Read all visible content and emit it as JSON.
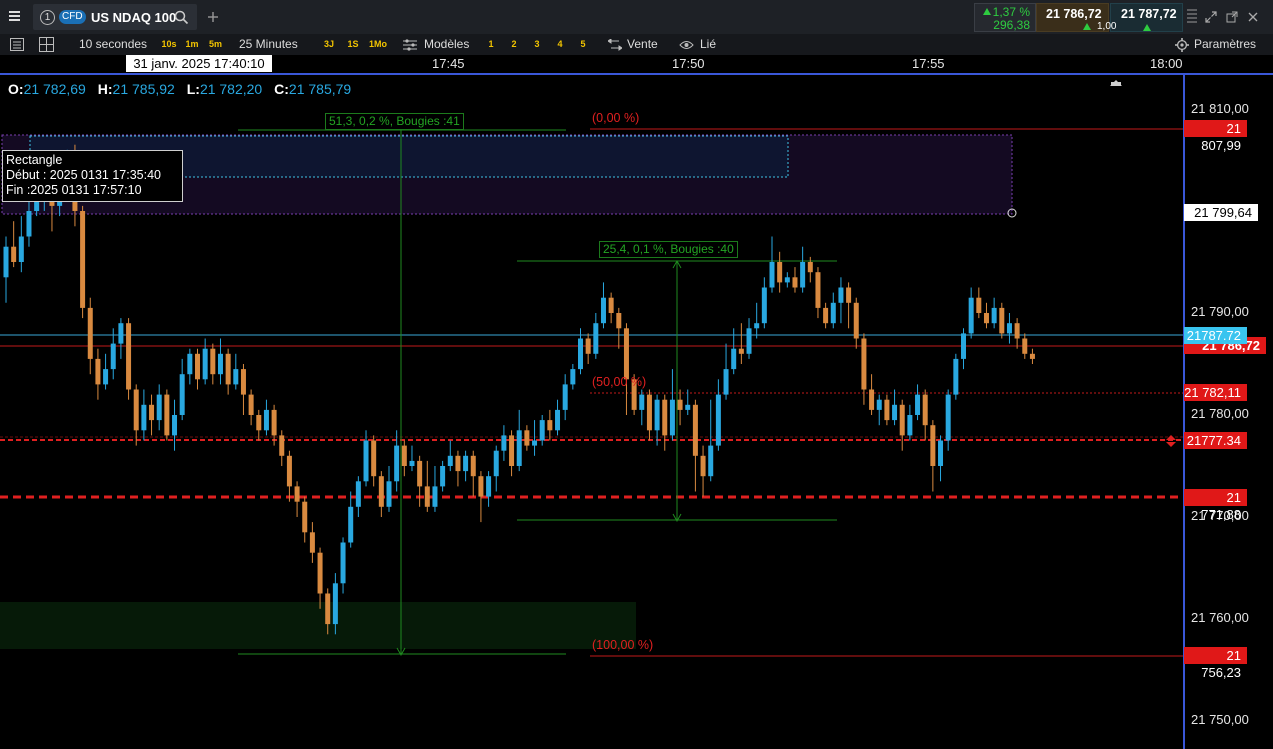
{
  "header": {
    "tab_number": "1",
    "cfd_badge": "CFD",
    "instrument": "US NDAQ 100",
    "change_pct": "1,37 %",
    "change_abs": "296,38",
    "bid": "21 786,72",
    "ask": "21 787,72",
    "spread": "1,00"
  },
  "toolbar": {
    "interval": "10 secondes",
    "quick_intervals": [
      "10s",
      "1m",
      "5m"
    ],
    "period": "25 Minutes",
    "quick_periods": [
      "3J",
      "1S",
      "1Mo"
    ],
    "models_label": "Modèles",
    "slots": [
      "1",
      "2",
      "3",
      "4",
      "5"
    ],
    "sell_label": "Vente",
    "linked_label": "Lié",
    "settings_label": "Paramètres"
  },
  "time_axis": {
    "cursor_label": "31 janv. 2025 17:40:10",
    "ticks": [
      "17:45",
      "17:50",
      "17:55",
      "18:00"
    ]
  },
  "ohlc": {
    "o_label": "O:",
    "o": "21 782,69",
    "h_label": "H:",
    "h": "21 785,92",
    "l_label": "L:",
    "l": "21 782,20",
    "c_label": "C:",
    "c": "21 785,79"
  },
  "price_axis": {
    "ticks": [
      "21 810,00",
      "21 790,00",
      "21 780,00",
      "21 770,00",
      "21 760,00",
      "21 750,00"
    ],
    "level_fib_top": "21 807,99",
    "rect_level": "21 799,64",
    "bid_marker": "21787.72",
    "ask_marker": "21 786,72",
    "fib_mid": "21 782,11",
    "alert_level": "21777.34",
    "dashed_level": "21 771,88",
    "fib_bottom": "21 756,23"
  },
  "annotations": {
    "rect_title": "Rectangle",
    "rect_start": "Début : 2025 0131 17:35:40",
    "rect_end": "Fin :2025 0131 17:57:10",
    "measure1": "51,3, 0,2 %, Bougies :41",
    "measure2": "25,4, 0,1 %, Bougies :40",
    "fib_0": "(0,00 %)",
    "fib_50": "(50,00 %)",
    "fib_100": "(100,00 %)"
  },
  "colors": {
    "up": "#29a8e0",
    "down": "#d98a40",
    "level_red": "#e02020",
    "measure_green": "#23a423",
    "axis_blue": "#3a57d8"
  },
  "chart_data": {
    "type": "candlestick",
    "y_range": [
      21746,
      21815
    ],
    "candles": [
      [
        21793.5,
        21796.5,
        21797.5,
        21791.0
      ],
      [
        21796.5,
        21795.0,
        21799.0,
        21794.5
      ],
      [
        21795.0,
        21797.5,
        21799.5,
        21794.0
      ],
      [
        21797.5,
        21800.0,
        21802.5,
        21796.5
      ],
      [
        21800.0,
        21802.5,
        21804.0,
        21799.5
      ],
      [
        21802.5,
        21803.0,
        21805.0,
        21800.0
      ],
      [
        21803.0,
        21800.5,
        21803.5,
        21798.0
      ],
      [
        21800.5,
        21803.5,
        21805.5,
        21799.5
      ],
      [
        21803.5,
        21804.5,
        21806.0,
        21802.5
      ],
      [
        21804.5,
        21800.0,
        21806.5,
        21798.5
      ],
      [
        21800.0,
        21790.5,
        21800.5,
        21789.5
      ],
      [
        21790.5,
        21785.5,
        21791.5,
        21784.0
      ],
      [
        21785.5,
        21783.0,
        21786.5,
        21781.5
      ],
      [
        21783.0,
        21784.5,
        21786.0,
        21782.5
      ],
      [
        21784.5,
        21787.0,
        21788.5,
        21783.5
      ],
      [
        21787.0,
        21789.0,
        21789.5,
        21785.5
      ],
      [
        21789.0,
        21782.5,
        21789.5,
        21781.5
      ],
      [
        21782.5,
        21778.5,
        21783.0,
        21777.0
      ],
      [
        21778.5,
        21781.0,
        21782.5,
        21777.5
      ],
      [
        21781.0,
        21779.5,
        21782.0,
        21778.0
      ],
      [
        21779.5,
        21782.0,
        21783.0,
        21778.5
      ],
      [
        21782.0,
        21778.0,
        21782.5,
        21777.5
      ],
      [
        21778.0,
        21780.0,
        21781.5,
        21776.5
      ],
      [
        21780.0,
        21784.0,
        21785.5,
        21779.5
      ],
      [
        21784.0,
        21786.0,
        21786.5,
        21783.0
      ],
      [
        21786.0,
        21783.5,
        21786.5,
        21782.5
      ],
      [
        21783.5,
        21786.5,
        21787.5,
        21783.0
      ],
      [
        21786.5,
        21784.0,
        21787.0,
        21783.0
      ],
      [
        21784.0,
        21786.0,
        21787.5,
        21783.0
      ],
      [
        21786.0,
        21783.0,
        21786.5,
        21782.0
      ],
      [
        21783.0,
        21784.5,
        21786.0,
        21782.5
      ],
      [
        21784.5,
        21782.0,
        21785.0,
        21780.0
      ],
      [
        21782.0,
        21780.0,
        21782.5,
        21779.0
      ],
      [
        21780.0,
        21778.5,
        21780.5,
        21777.5
      ],
      [
        21778.5,
        21780.5,
        21781.5,
        21778.0
      ],
      [
        21780.5,
        21778.0,
        21781.0,
        21777.0
      ],
      [
        21778.0,
        21776.0,
        21778.5,
        21775.0
      ],
      [
        21776.0,
        21773.0,
        21776.5,
        21771.5
      ],
      [
        21773.0,
        21771.5,
        21773.5,
        21770.0
      ],
      [
        21771.5,
        21768.5,
        21772.0,
        21767.5
      ],
      [
        21768.5,
        21766.5,
        21769.5,
        21765.5
      ],
      [
        21766.5,
        21762.5,
        21767.0,
        21761.0
      ],
      [
        21762.5,
        21759.5,
        21763.0,
        21758.5
      ],
      [
        21759.5,
        21763.5,
        21764.5,
        21758.5
      ],
      [
        21763.5,
        21767.5,
        21768.0,
        21762.5
      ],
      [
        21767.5,
        21771.0,
        21772.5,
        21767.0
      ],
      [
        21771.0,
        21773.5,
        21774.0,
        21770.0
      ],
      [
        21773.5,
        21777.5,
        21778.5,
        21773.0
      ],
      [
        21777.5,
        21774.0,
        21778.0,
        21773.0
      ],
      [
        21774.0,
        21771.0,
        21774.5,
        21770.0
      ],
      [
        21771.0,
        21773.5,
        21775.0,
        21770.5
      ],
      [
        21773.5,
        21777.0,
        21778.5,
        21772.5
      ],
      [
        21777.0,
        21775.0,
        21777.5,
        21774.0
      ],
      [
        21775.0,
        21775.5,
        21777.0,
        21774.5
      ],
      [
        21775.5,
        21773.0,
        21776.0,
        21771.0
      ],
      [
        21773.0,
        21771.0,
        21775.5,
        21770.5
      ],
      [
        21771.0,
        21773.0,
        21775.0,
        21770.5
      ],
      [
        21773.0,
        21775.0,
        21775.5,
        21772.5
      ],
      [
        21775.0,
        21776.0,
        21777.5,
        21774.5
      ],
      [
        21776.0,
        21774.5,
        21776.5,
        21773.0
      ],
      [
        21774.5,
        21776.0,
        21776.5,
        21773.5
      ],
      [
        21776.0,
        21774.0,
        21776.5,
        21772.0
      ],
      [
        21774.0,
        21772.0,
        21774.5,
        21769.5
      ],
      [
        21772.0,
        21774.0,
        21774.5,
        21771.0
      ],
      [
        21774.0,
        21776.5,
        21777.0,
        21772.5
      ],
      [
        21776.5,
        21778.0,
        21779.0,
        21775.5
      ],
      [
        21778.0,
        21775.0,
        21778.5,
        21774.0
      ],
      [
        21775.0,
        21778.5,
        21780.5,
        21774.5
      ],
      [
        21778.5,
        21777.0,
        21779.0,
        21776.5
      ],
      [
        21777.0,
        21777.5,
        21779.5,
        21776.0
      ],
      [
        21777.5,
        21779.5,
        21780.0,
        21777.0
      ],
      [
        21779.5,
        21778.5,
        21780.5,
        21777.5
      ],
      [
        21778.5,
        21780.5,
        21781.5,
        21778.0
      ],
      [
        21780.5,
        21783.0,
        21784.0,
        21779.5
      ],
      [
        21783.0,
        21784.5,
        21785.0,
        21782.5
      ],
      [
        21784.5,
        21787.5,
        21788.5,
        21784.0
      ],
      [
        21787.5,
        21786.0,
        21788.0,
        21785.0
      ],
      [
        21786.0,
        21789.0,
        21790.0,
        21785.5
      ],
      [
        21789.0,
        21791.5,
        21793.0,
        21788.5
      ],
      [
        21791.5,
        21790.0,
        21792.0,
        21789.0
      ],
      [
        21790.0,
        21788.5,
        21790.5,
        21786.5
      ],
      [
        21788.5,
        21783.5,
        21789.0,
        21780.0
      ],
      [
        21783.5,
        21780.5,
        21784.0,
        21780.0
      ],
      [
        21780.5,
        21782.0,
        21782.5,
        21779.0
      ],
      [
        21782.0,
        21778.5,
        21782.5,
        21777.5
      ],
      [
        21778.5,
        21781.5,
        21782.0,
        21777.0
      ],
      [
        21781.5,
        21778.0,
        21782.0,
        21776.5
      ],
      [
        21778.0,
        21781.5,
        21784.5,
        21777.5
      ],
      [
        21781.5,
        21780.5,
        21782.5,
        21779.0
      ],
      [
        21780.5,
        21781.0,
        21782.5,
        21780.0
      ],
      [
        21781.0,
        21776.0,
        21781.5,
        21772.5
      ],
      [
        21776.0,
        21774.0,
        21777.0,
        21772.0
      ],
      [
        21774.0,
        21777.0,
        21781.5,
        21773.5
      ],
      [
        21777.0,
        21782.0,
        21783.5,
        21776.5
      ],
      [
        21782.0,
        21784.5,
        21787.0,
        21781.5
      ],
      [
        21784.5,
        21786.5,
        21788.5,
        21784.0
      ],
      [
        21786.5,
        21786.0,
        21789.0,
        21785.0
      ],
      [
        21786.0,
        21788.5,
        21789.5,
        21785.5
      ],
      [
        21788.5,
        21789.0,
        21791.0,
        21787.5
      ],
      [
        21789.0,
        21792.5,
        21793.5,
        21788.5
      ],
      [
        21792.5,
        21795.0,
        21797.5,
        21792.0
      ],
      [
        21795.0,
        21793.0,
        21796.0,
        21792.0
      ],
      [
        21793.0,
        21793.5,
        21794.0,
        21792.5
      ],
      [
        21793.5,
        21792.5,
        21794.5,
        21792.0
      ],
      [
        21792.5,
        21795.0,
        21796.5,
        21792.0
      ],
      [
        21795.0,
        21794.0,
        21795.5,
        21793.0
      ],
      [
        21794.0,
        21790.5,
        21794.5,
        21789.5
      ],
      [
        21790.5,
        21789.0,
        21791.0,
        21788.5
      ],
      [
        21789.0,
        21791.0,
        21792.0,
        21788.5
      ],
      [
        21791.0,
        21792.5,
        21793.5,
        21789.0
      ],
      [
        21792.5,
        21791.0,
        21793.0,
        21788.5
      ],
      [
        21791.0,
        21787.5,
        21791.5,
        21786.5
      ],
      [
        21787.5,
        21782.5,
        21788.0,
        21781.0
      ],
      [
        21782.5,
        21780.5,
        21784.0,
        21780.0
      ],
      [
        21780.5,
        21781.5,
        21782.0,
        21779.0
      ],
      [
        21781.5,
        21779.5,
        21782.0,
        21779.0
      ],
      [
        21779.5,
        21781.0,
        21782.5,
        21779.0
      ],
      [
        21781.0,
        21778.0,
        21781.5,
        21776.5
      ],
      [
        21778.0,
        21780.0,
        21781.0,
        21777.5
      ],
      [
        21780.0,
        21782.0,
        21783.0,
        21779.5
      ],
      [
        21782.0,
        21779.0,
        21782.5,
        21777.5
      ],
      [
        21779.0,
        21775.0,
        21779.5,
        21772.5
      ],
      [
        21775.0,
        21777.5,
        21778.0,
        21773.5
      ],
      [
        21777.5,
        21782.0,
        21782.5,
        21776.5
      ],
      [
        21782.0,
        21785.5,
        21786.0,
        21781.5
      ],
      [
        21785.5,
        21788.0,
        21788.5,
        21784.5
      ],
      [
        21788.0,
        21791.5,
        21792.5,
        21787.5
      ],
      [
        21791.5,
        21790.0,
        21792.5,
        21789.5
      ],
      [
        21790.0,
        21789.0,
        21791.0,
        21788.5
      ],
      [
        21789.0,
        21790.5,
        21791.5,
        21788.5
      ],
      [
        21790.5,
        21788.0,
        21791.0,
        21787.5
      ],
      [
        21788.0,
        21789.0,
        21790.0,
        21787.0
      ],
      [
        21789.0,
        21787.5,
        21789.5,
        21786.5
      ],
      [
        21787.5,
        21786.0,
        21788.0,
        21785.5
      ],
      [
        21786.0,
        21785.5,
        21786.5,
        21785.0
      ]
    ]
  }
}
